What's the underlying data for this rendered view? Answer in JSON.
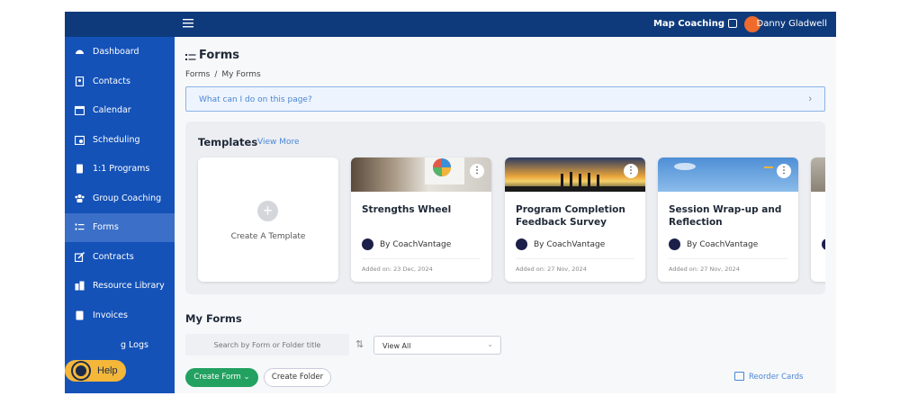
{
  "topbar": {
    "org_name": "Map Coaching",
    "user_name": "Danny Gladwell",
    "avatar_color": "#f06a2b"
  },
  "sidebar": {
    "items": [
      {
        "label": "Dashboard",
        "icon": "dashboard-icon"
      },
      {
        "label": "Contacts",
        "icon": "contacts-icon"
      },
      {
        "label": "Calendar",
        "icon": "calendar-icon"
      },
      {
        "label": "Scheduling",
        "icon": "scheduling-icon"
      },
      {
        "label": "1:1 Programs",
        "icon": "programs-icon"
      },
      {
        "label": "Group Coaching",
        "icon": "group-icon"
      },
      {
        "label": "Forms",
        "icon": "forms-icon",
        "active": true
      },
      {
        "label": "Contracts",
        "icon": "contracts-icon"
      },
      {
        "label": "Resource Library",
        "icon": "library-icon"
      },
      {
        "label": "Invoices",
        "icon": "invoices-icon"
      },
      {
        "label": "g Logs",
        "icon": "logs-icon"
      }
    ],
    "help_label": "Help"
  },
  "page": {
    "title": "Forms",
    "breadcrumb": [
      "Forms",
      "My Forms"
    ],
    "help_prompt": "What can I do on this page?"
  },
  "templates": {
    "title": "Templates",
    "view_more": "View More",
    "create_label": "Create A Template",
    "cards": [
      {
        "name": "Strengths Wheel",
        "author": "By CoachVantage",
        "added": "Added on: 23 Dec, 2024"
      },
      {
        "name": "Program Completion Feedback Survey",
        "author": "By CoachVantage",
        "added": "Added on: 27 Nov, 2024"
      },
      {
        "name": "Session Wrap-up and Reflection",
        "author": "By CoachVantage",
        "added": "Added on: 27 Nov, 2024"
      }
    ]
  },
  "my_forms": {
    "title": "My Forms",
    "search_placeholder": "Search by Form or Folder title",
    "view_value": "View All",
    "create_form": "Create Form",
    "create_folder": "Create Folder",
    "reorder": "Reorder Cards"
  }
}
